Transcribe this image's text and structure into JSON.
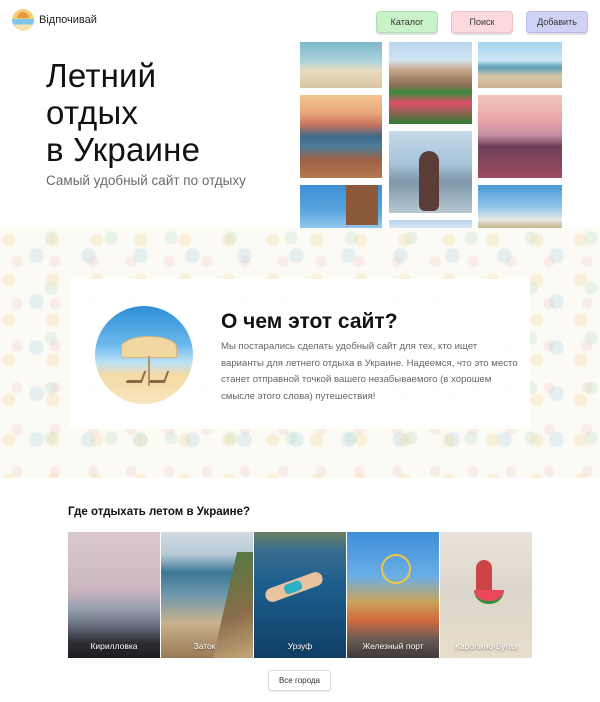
{
  "header": {
    "logo_text": "Відпочивай",
    "nav": {
      "catalog": "Каталог",
      "search": "Поиск",
      "add": "Добавить"
    }
  },
  "hero": {
    "title_line1": "Летний",
    "title_line2": "отдых",
    "title_line3": "в Украине",
    "subtitle": "Самый удобный сайт по отдыху"
  },
  "about": {
    "title": "О чем этот сайт?",
    "text": "Мы постарались сделать удобный сайт для тех, кто ищет варианты для летнего отдыха в Украине. Надеемся, что это место станет отправной точкой вашего незабываемого (в хорошем смысле этого слова) путешествия!"
  },
  "cities": {
    "title": "Где отдыхать летом в Украине?",
    "items": [
      {
        "label": "Кирилловка"
      },
      {
        "label": "Затока"
      },
      {
        "label": "Урзуф"
      },
      {
        "label": "Железный порт"
      },
      {
        "label": "Каролино-Бугаз"
      }
    ],
    "all_button": "Все города"
  },
  "colors": {
    "nav_catalog": "#c9f2c9",
    "nav_search": "#fbd9dc",
    "nav_add": "#cfd2f5"
  }
}
